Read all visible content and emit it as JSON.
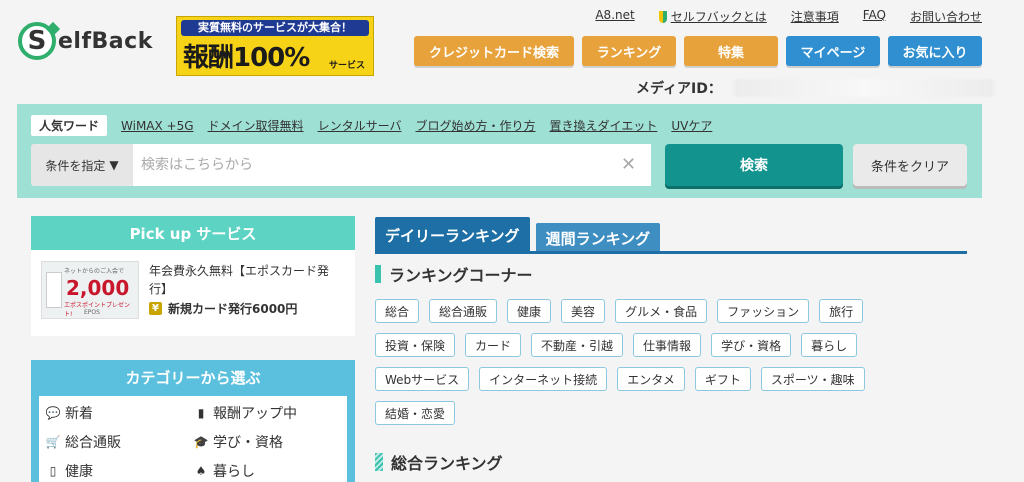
{
  "logo": {
    "mark": "S",
    "text": "elfBack"
  },
  "banner": {
    "top": "実質無料のサービスが大集合！",
    "main": "報酬100%",
    "sub": "サービス"
  },
  "toplinks": [
    "A8.net",
    "セルフバックとは",
    "注意事項",
    "FAQ",
    "お問い合わせ"
  ],
  "navbuttons": [
    "クレジットカード検索",
    "ランキング",
    "特集",
    "マイページ",
    "お気に入り"
  ],
  "media": {
    "label": "メディアID："
  },
  "search": {
    "popular_label": "人気ワード",
    "popular_words": [
      "WiMAX +5G",
      "ドメイン取得無料",
      "レンタルサーバ",
      "ブログ始め方・作り方",
      "置き換えダイエット",
      "UVケア"
    ],
    "condition_label": "条件を指定",
    "condition_arrow": "▼",
    "placeholder": "検索はこちらから",
    "clear_x": "✕",
    "search_button": "検索",
    "clear_button": "条件をクリア"
  },
  "pickup": {
    "heading": "Pick up サービス",
    "title": "年会費永久無料【エポスカード発行】",
    "reward": "新規カード発行6000円",
    "yen": "¥",
    "image": {
      "small_top": "ネットからのご入会で",
      "amount": "2,000",
      "small_mid": "エポスポイントプレゼント!",
      "brand": "EPOS"
    }
  },
  "category": {
    "heading": "カテゴリーから選ぶ",
    "items": [
      {
        "icon": "speech-bubble-icon",
        "glyph": "💬",
        "label": "新着"
      },
      {
        "icon": "bar-chart-icon",
        "glyph": "▮",
        "label": "報酬アップ中"
      },
      {
        "icon": "cart-icon",
        "glyph": "🛒",
        "label": "総合通販"
      },
      {
        "icon": "graduation-cap-icon",
        "glyph": "🎓",
        "label": "学び・資格"
      },
      {
        "icon": "bottle-icon",
        "glyph": "▯",
        "label": "健康"
      },
      {
        "icon": "spade-icon",
        "glyph": "♠",
        "label": "暮らし"
      }
    ]
  },
  "ranking": {
    "tabs": [
      "デイリーランキング",
      "週間ランキング"
    ],
    "corner_title": "ランキングコーナー",
    "tags": [
      "総合",
      "総合通販",
      "健康",
      "美容",
      "グルメ・食品",
      "ファッション",
      "旅行",
      "投資・保険",
      "カード",
      "不動産・引越",
      "仕事情報",
      "学び・資格",
      "暮らし",
      "Webサービス",
      "インターネット接続",
      "エンタメ",
      "ギフト",
      "スポーツ・趣味",
      "結婚・恋愛"
    ],
    "sogo_title": "総合ランキング"
  },
  "colors": {
    "teal": "#9fe0d4",
    "orange": "#e8a23c",
    "blue": "#2f8fd0",
    "search_btn": "#12938e",
    "tab": "#1d6fa5"
  }
}
